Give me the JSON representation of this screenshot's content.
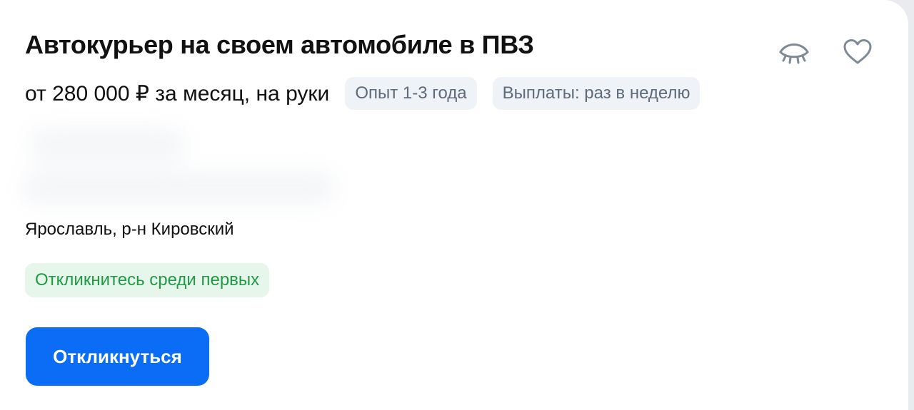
{
  "vacancy": {
    "title": "Автокурьер на своем автомобиле в ПВЗ",
    "salary": "от 280 000 ₽ за месяц, на руки",
    "tags": {
      "experience": "Опыт 1-3 года",
      "payments": "Выплаты: раз в неделю"
    },
    "location": "Ярославль, р-н Кировский",
    "early_badge": "Откликнитесь среди первых",
    "respond_label": "Откликнуться"
  },
  "icons": {
    "hide": "eye-closed-icon",
    "favorite": "heart-icon"
  },
  "colors": {
    "primary_button": "#0b6df5",
    "badge_green_text": "#1f9b45",
    "badge_green_bg": "#e7f6ea",
    "chip_bg": "#eff2f6"
  }
}
